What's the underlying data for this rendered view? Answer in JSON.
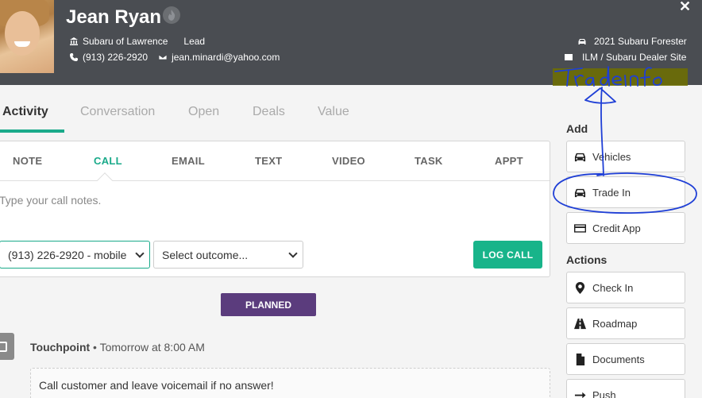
{
  "header": {
    "name": "Jean Ryan",
    "dealership": "Subaru of Lawrence",
    "status": "Lead",
    "phone": "(913) 226-2920",
    "email": "jean.minardi@yahoo.com",
    "vehicle": "2021 Subaru Forester",
    "source": "ILM / Subaru Dealer Site",
    "close_glyph": "✕"
  },
  "tabs": [
    {
      "label": "Activity",
      "active": true
    },
    {
      "label": "Conversation",
      "active": false
    },
    {
      "label": "Open",
      "active": false
    },
    {
      "label": "Deals",
      "active": false
    },
    {
      "label": "Value",
      "active": false
    }
  ],
  "activity_types": [
    {
      "label": "NOTE"
    },
    {
      "label": "CALL",
      "active": true
    },
    {
      "label": "EMAIL"
    },
    {
      "label": "TEXT"
    },
    {
      "label": "VIDEO"
    },
    {
      "label": "TASK"
    },
    {
      "label": "APPT"
    }
  ],
  "call_form": {
    "placeholder": "Type your call notes.",
    "phone_select": "(913) 226-2920 - mobile",
    "outcome_select": "Select outcome...",
    "log_button": "LOG CALL"
  },
  "planned_label": "PLANNED",
  "touchpoint": {
    "title": "Touchpoint",
    "separator": " • ",
    "when": "Tomorrow at 8:00 AM",
    "note": "Call customer and leave voicemail if no answer!"
  },
  "sidebar": {
    "add_heading": "Add",
    "add_items": [
      {
        "label": "Vehicles",
        "icon": "car-icon"
      },
      {
        "label": "Trade In",
        "icon": "car-icon"
      },
      {
        "label": "Credit App",
        "icon": "credit-card-icon"
      }
    ],
    "actions_heading": "Actions",
    "action_items": [
      {
        "label": "Check In",
        "icon": "map-pin-icon"
      },
      {
        "label": "Roadmap",
        "icon": "road-icon"
      },
      {
        "label": "Documents",
        "icon": "document-icon"
      },
      {
        "label": "Push",
        "icon": "arrow-right-icon"
      }
    ]
  },
  "annotation": {
    "handwritten_text": "Trade Info",
    "ink_color": "#1f3fd6",
    "highlight_color": "#6e7000"
  },
  "colors": {
    "header_bg": "#4a4d52",
    "accent": "#1aaa8a",
    "log_button": "#18b48a",
    "planned": "#5b3c7d"
  }
}
